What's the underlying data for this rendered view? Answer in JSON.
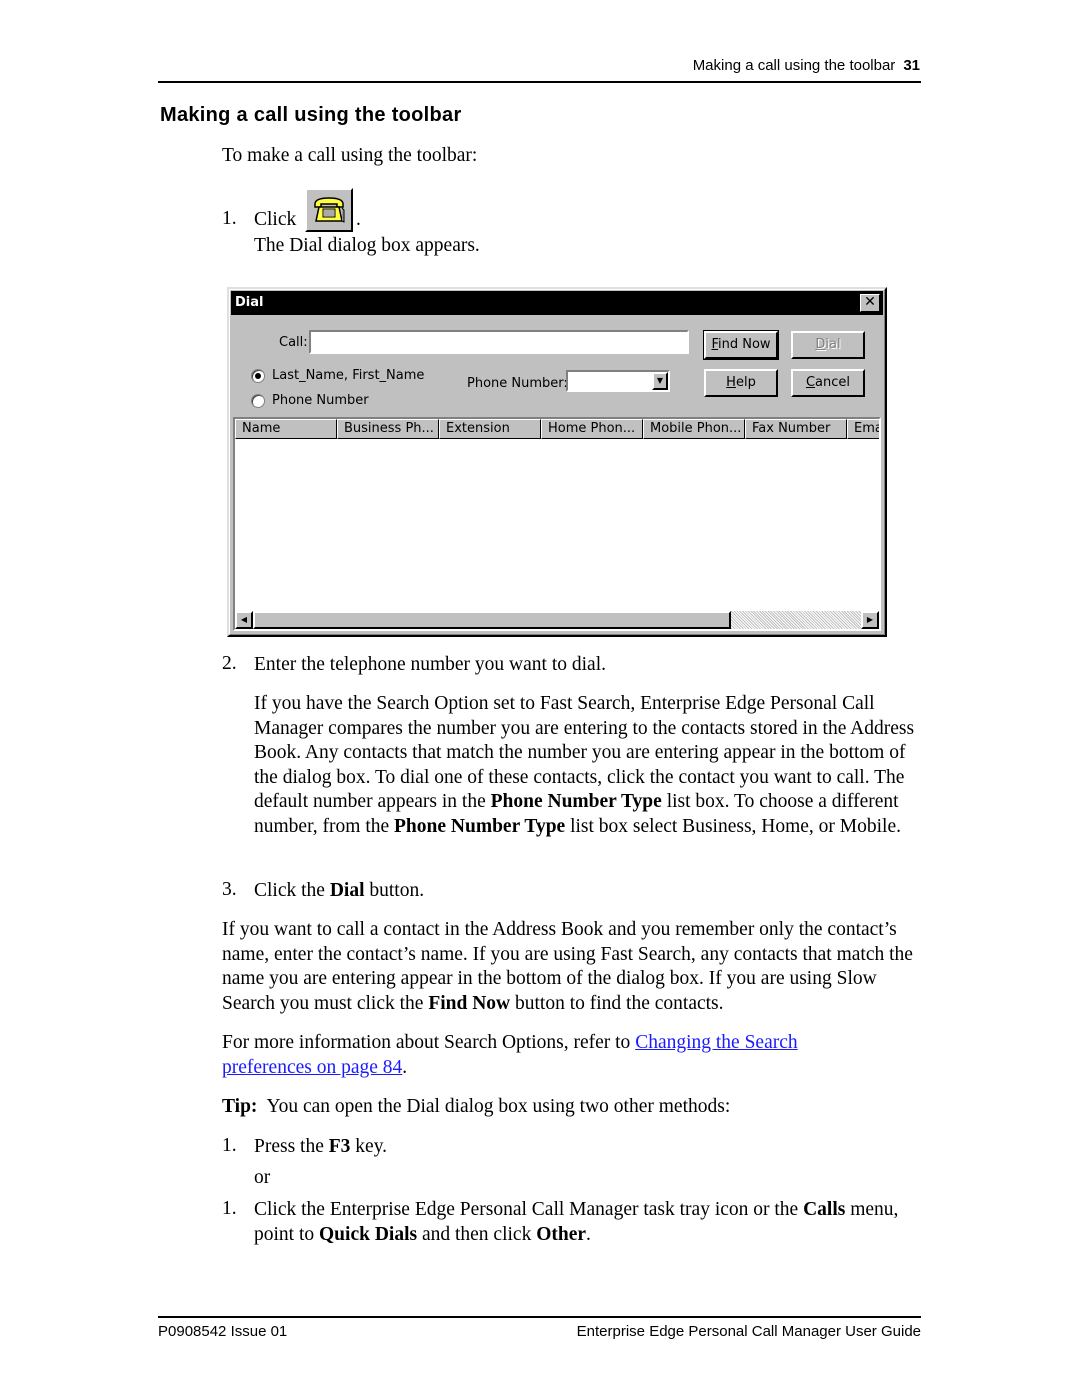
{
  "header": {
    "running_title": "Making a call using the toolbar",
    "page_number": "31"
  },
  "section_title": "Making a call using the toolbar",
  "intro": "To make a call using the toolbar:",
  "step1": {
    "number": "1.",
    "text_before_icon": "Click",
    "text_after_icon": ".",
    "icon": "telephone-icon",
    "result": "The Dial dialog box appears."
  },
  "dialog": {
    "title": "Dial",
    "close_glyph": "✕",
    "call_label": "Call:",
    "call_value": "",
    "radio_options": [
      {
        "label": "Last_Name, First_Name",
        "selected": true
      },
      {
        "label": "Phone Number",
        "selected": false
      }
    ],
    "phone_number_label": "Phone Number:",
    "phone_number_value": "",
    "buttons": {
      "find_now": {
        "mnemonic": "F",
        "rest": "ind Now",
        "enabled": true,
        "default": true
      },
      "dial": {
        "mnemonic": "D",
        "rest": "ial",
        "enabled": false
      },
      "help": {
        "mnemonic": "H",
        "rest": "elp",
        "enabled": true
      },
      "cancel": {
        "mnemonic": "C",
        "rest": "ancel",
        "enabled": true
      }
    },
    "columns": [
      "Name",
      "Business Ph...",
      "Extension",
      "Home Phon...",
      "Mobile Phon...",
      "Fax Number",
      "Ema"
    ],
    "scroll_left_glyph": "◀",
    "scroll_right_glyph": "▶",
    "dropdown_glyph": "▼"
  },
  "step2": {
    "number": "2.",
    "text": "Enter the telephone number you want to dial.",
    "para_1": "If you have the Search Option set to Fast Search, Enterprise Edge Personal Call Manager compares the number you are entering to the contacts stored in the Address Book. Any contacts that match the number you are entering appear in the bottom of the dialog box. To dial one of these contacts, click the contact you want to call. The default number appears in the ",
    "bold_1": "Phone Number Type",
    "para_2": " list box. To choose a different number, from the ",
    "bold_2": "Phone Number Type",
    "para_3": " list box select Business, Home, or Mobile."
  },
  "step3": {
    "number": "3.",
    "pre": "Click the ",
    "bold": "Dial",
    "post": " button."
  },
  "para_name_search": {
    "pre": "If you want to call a contact in the Address Book and you remember only the contact’s name, enter the contact’s name. If you are using Fast Search, any contacts that match the name you are entering appear in the bottom of the dialog box. If you are using Slow Search you must click the ",
    "bold": "Find Now",
    "post": " button to find the contacts."
  },
  "para_more_info": {
    "pre": "For more information about Search Options, refer to ",
    "link": "Changing the Search preferences on page 84",
    "post": "."
  },
  "tip": {
    "label": "Tip:",
    "text": "  You can open the Dial dialog box using two other methods:",
    "method1": {
      "number": "1.",
      "pre": "Press the ",
      "bold": "F3",
      "post": " key."
    },
    "or": "or",
    "method2": {
      "number": "1.",
      "pre": "Click the Enterprise Edge Personal Call Manager task tray icon or the ",
      "bold1": "Calls",
      "mid1": " menu, point to ",
      "bold2": "Quick Dials",
      "mid2": " and then click ",
      "bold3": "Other",
      "post": "."
    }
  },
  "footer": {
    "left": "P0908542 Issue 01",
    "right": "Enterprise Edge Personal Call Manager User Guide"
  },
  "colors": {
    "link": "#1a1aff",
    "dialog_face": "#c0c0c0",
    "titlebar": "#000000"
  }
}
